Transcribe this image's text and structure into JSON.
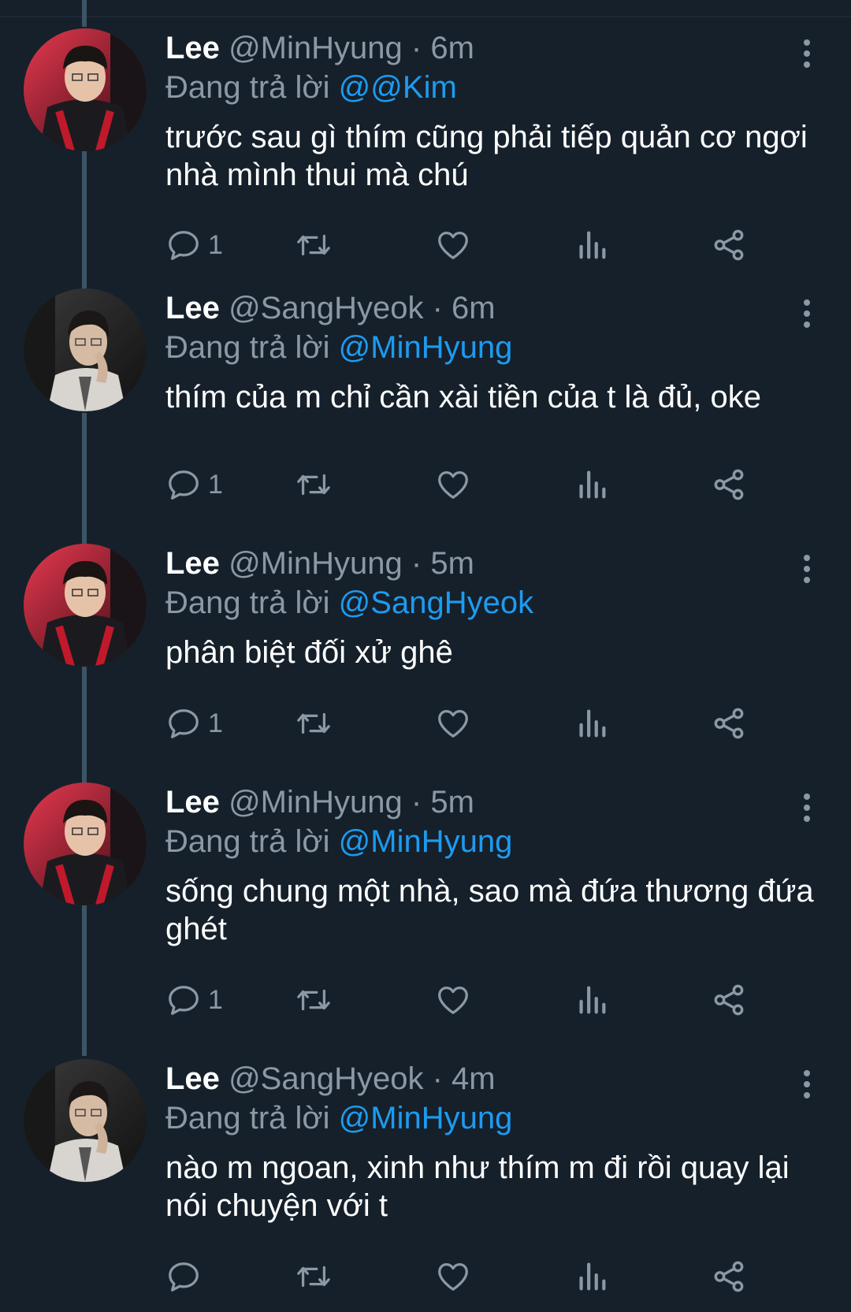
{
  "tweets": [
    {
      "name": "Lee",
      "handle": "@MinHyung",
      "separator": "·",
      "time": "6m",
      "reply_prefix": "Đang trả lời",
      "reply_to": "@@Kim",
      "text": "trước sau gì thím cũng phải tiếp quản cơ ngơi nhà mình thui mà chú",
      "reply_count": "1",
      "avatar": "minhyung"
    },
    {
      "name": "Lee",
      "handle": "@SangHyeok",
      "separator": "·",
      "time": "6m",
      "reply_prefix": "Đang trả lời",
      "reply_to": "@MinHyung",
      "text": "thím của m chỉ cần xài tiền của t là đủ, oke",
      "reply_count": "1",
      "avatar": "sanghyeok"
    },
    {
      "name": "Lee",
      "handle": "@MinHyung",
      "separator": "·",
      "time": "5m",
      "reply_prefix": "Đang trả lời",
      "reply_to": "@SangHyeok",
      "text": "phân biệt đối xử ghê",
      "reply_count": "1",
      "avatar": "minhyung"
    },
    {
      "name": "Lee",
      "handle": "@MinHyung",
      "separator": "·",
      "time": "5m",
      "reply_prefix": "Đang trả lời",
      "reply_to": "@MinHyung",
      "text": "sống chung một nhà, sao mà đứa thương đứa ghét",
      "reply_count": "1",
      "avatar": "minhyung"
    },
    {
      "name": "Lee",
      "handle": "@SangHyeok",
      "separator": "·",
      "time": "4m",
      "reply_prefix": "Đang trả lời",
      "reply_to": "@MinHyung",
      "text": "nào m ngoan, xinh như thím m đi rồi quay lại nói chuyện với t",
      "reply_count": "",
      "avatar": "sanghyeok"
    }
  ],
  "icons": {
    "reply": "reply-icon",
    "retweet": "retweet-icon",
    "like": "like-icon",
    "views": "views-icon",
    "share": "share-icon",
    "more": "more-options-icon"
  },
  "colors": {
    "background": "#15202b",
    "mention": "#1d9bf0",
    "secondary_text": "#8b98a5",
    "thread_line": "#3d5466"
  }
}
